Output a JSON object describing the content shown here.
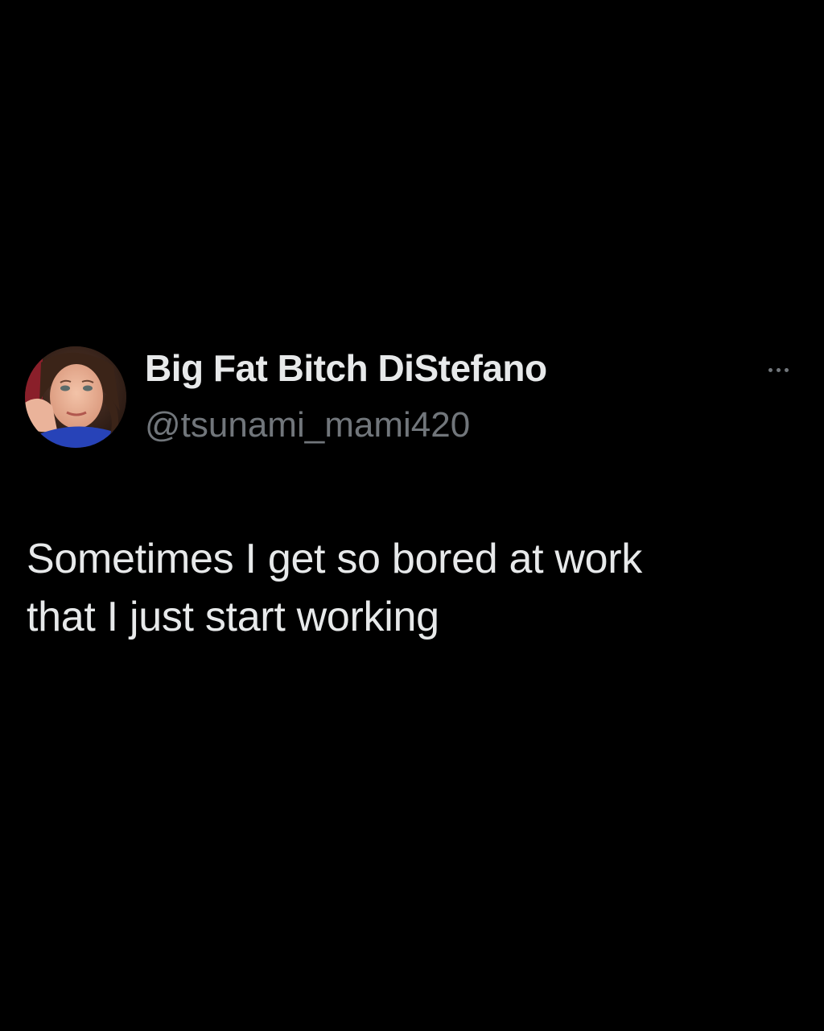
{
  "tweet": {
    "display_name": "Big Fat Bitch DiStefano",
    "handle": "@tsunami_mami420",
    "text_lines": [
      "Sometimes I get so bored at work",
      "that I just start working"
    ],
    "avatar_icon": "profile-photo",
    "more_icon": "more-horizontal-icon"
  },
  "colors": {
    "background": "#000000",
    "primary_text": "#e7e9ea",
    "secondary_text": "#71767b"
  }
}
